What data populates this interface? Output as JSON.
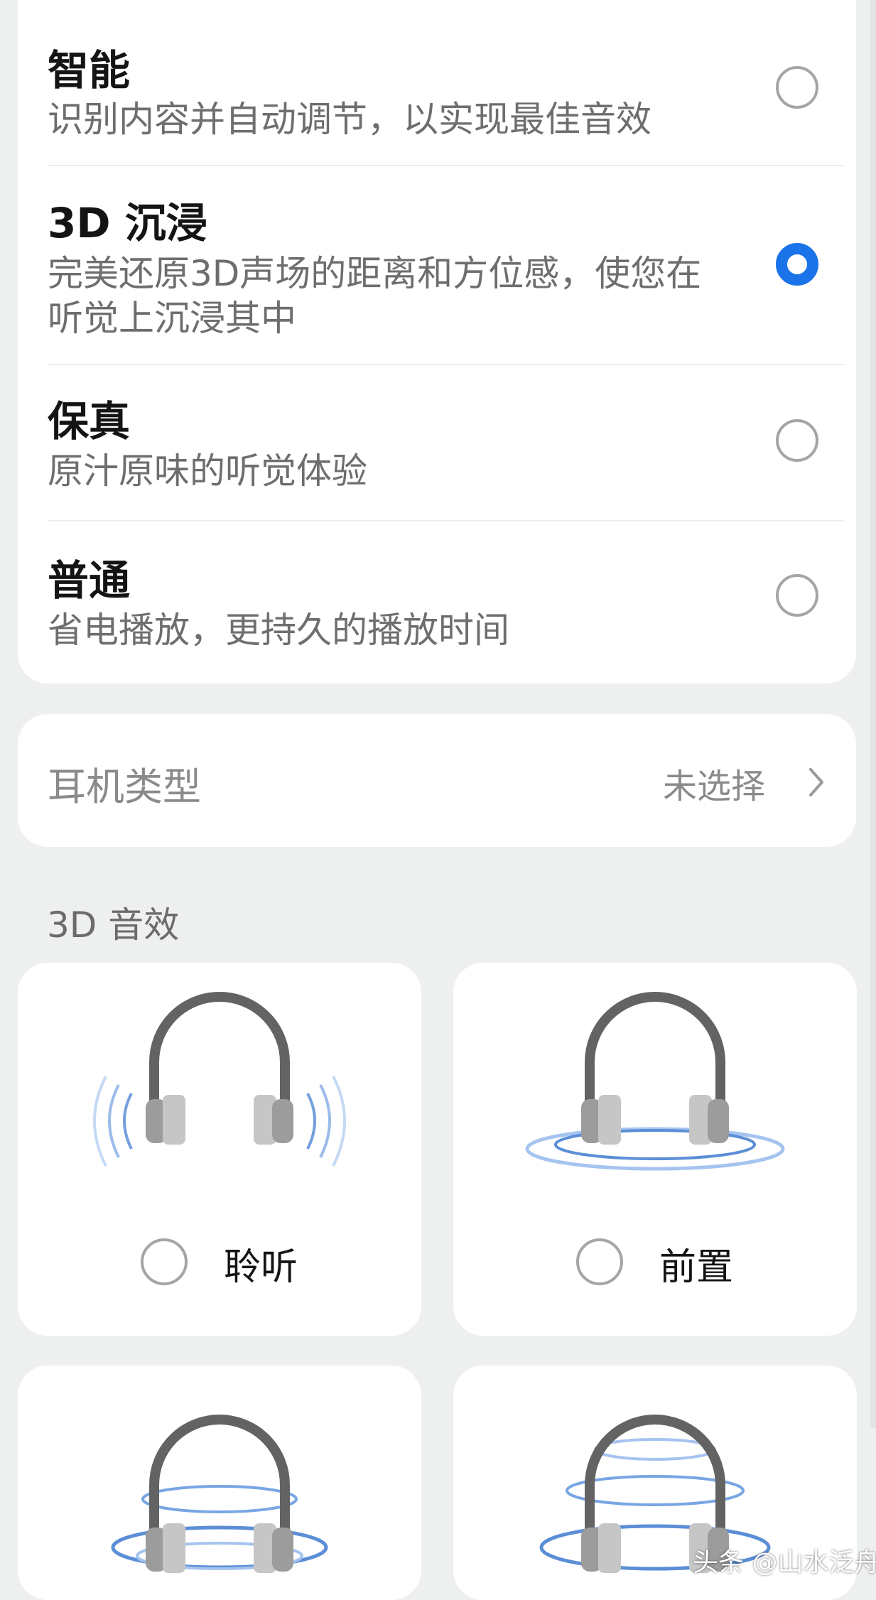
{
  "sound_modes": [
    {
      "title": "智能",
      "description": "识别内容并自动调节，以实现最佳音效",
      "selected": false
    },
    {
      "title": "3D 沉浸",
      "description": "完美还原3D声场的距离和方位感，使您在听觉上沉浸其中",
      "selected": true
    },
    {
      "title": "保真",
      "description": "原汁原味的听觉体验",
      "selected": false
    },
    {
      "title": "普通",
      "description": "省电播放，更持久的播放时间",
      "selected": false
    }
  ],
  "headphone_type": {
    "label": "耳机类型",
    "value": "未选择"
  },
  "effects_section": {
    "title": "3D 音效"
  },
  "effects": [
    {
      "label": "聆听",
      "selected": false
    },
    {
      "label": "前置",
      "selected": false
    },
    {
      "label": "",
      "selected": false
    },
    {
      "label": "",
      "selected": false
    }
  ],
  "watermark": "头条 @山水泛舟",
  "colors": {
    "accent": "#1a73e8",
    "background": "#eef0f0",
    "card": "#ffffff"
  }
}
